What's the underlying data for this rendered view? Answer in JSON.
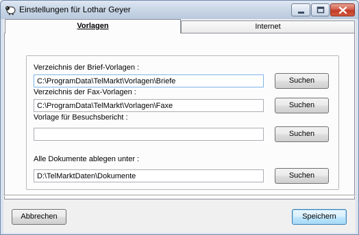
{
  "window": {
    "title": "Einstellungen für Lothar Geyer",
    "icon": "sheep-app-icon"
  },
  "tabs": [
    {
      "label": "Vorlagen",
      "active": true
    },
    {
      "label": "Internet",
      "active": false
    }
  ],
  "fields": [
    {
      "label": "Verzeichnis der Brief-Vorlagen :",
      "value": "C:\\ProgramData\\TelMarkt\\Vorlagen\\Briefe",
      "button": "Suchen"
    },
    {
      "label": "Verzeichnis der Fax-Vorlagen :",
      "value": "C:\\ProgramData\\TelMarkt\\Vorlagen\\Faxe",
      "button": "Suchen"
    },
    {
      "label": "Vorlage für Besuchsbericht :",
      "value": "",
      "button": "Suchen"
    },
    {
      "label": "Alle Dokumente ablegen unter :",
      "value": "D:\\TelMarktDaten\\Dokumente",
      "button": "Suchen"
    }
  ],
  "footer": {
    "cancel": "Abbrechen",
    "save": "Speichern"
  },
  "colors": {
    "titlebar": "#c8d6e6",
    "close_button": "#c03b27",
    "default_button": "#bee6fd"
  }
}
